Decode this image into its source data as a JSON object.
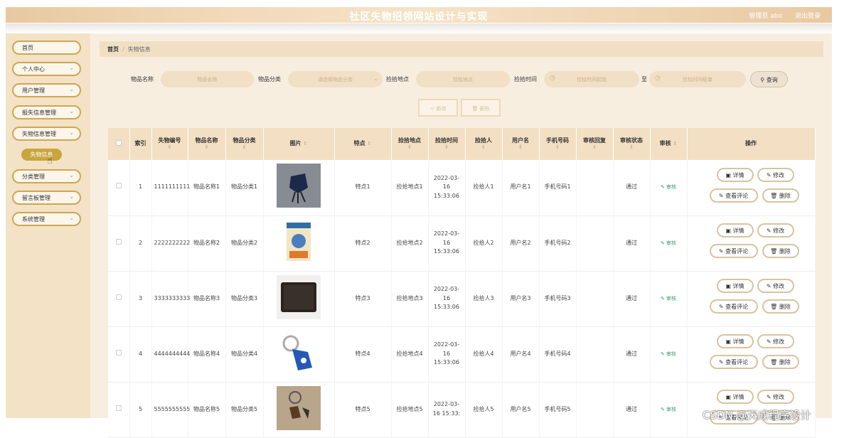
{
  "header": {
    "title": "社区失物招领网站设计与实现",
    "admin": "管理员 abo",
    "logout": "退出登录"
  },
  "sidebar": {
    "items": [
      {
        "label": "首页",
        "has_arrow": false
      },
      {
        "label": "个人中心",
        "has_arrow": true
      },
      {
        "label": "用户管理",
        "has_arrow": true
      },
      {
        "label": "报失信息管理",
        "has_arrow": true
      },
      {
        "label": "失物信息管理",
        "has_arrow": true
      },
      {
        "label": "分类管理",
        "has_arrow": true
      },
      {
        "label": "留言板管理",
        "has_arrow": true
      },
      {
        "label": "系统管理",
        "has_arrow": true
      }
    ],
    "active_sub": "失物信息"
  },
  "breadcrumb": {
    "home": "首页",
    "sep": "/",
    "current": "失物信息"
  },
  "filters": {
    "name_label": "物品名称",
    "name_placeholder": "物品名称",
    "category_label": "物品分类",
    "category_placeholder": "请选择物品分类",
    "place_label": "捡拾地点",
    "place_placeholder": "捡拾地点",
    "time_label": "捡拾时间",
    "time_start_placeholder": "捡拾时间起始",
    "to_label": "至",
    "time_end_placeholder": "捡拾时间结束",
    "search_label": "查询"
  },
  "actions": {
    "add": "新增",
    "delete": "删除"
  },
  "table": {
    "headers": {
      "index": "索引",
      "code": "失物编号",
      "name": "物品名称",
      "category": "物品分类",
      "image": "图片",
      "feature": "特点",
      "place": "捡拾地点",
      "time": "捡拾时间",
      "finder": "捡拾人",
      "username": "用户名",
      "phone": "手机号码",
      "reply": "审核回复",
      "status": "审核状态",
      "review": "审核",
      "ops": "操作"
    },
    "rows": [
      {
        "index": "1",
        "code": "1111111111",
        "name": "物品名称1",
        "category": "物品分类1",
        "feature": "特点1",
        "place": "捡拾地点1",
        "time": "2022-03-16 15:33:06",
        "finder": "捡拾人1",
        "username": "用户名1",
        "phone": "手机号码1",
        "reply": "",
        "status": "通过",
        "review": "审核"
      },
      {
        "index": "2",
        "code": "2222222222",
        "name": "物品名称2",
        "category": "物品分类2",
        "feature": "特点2",
        "place": "捡拾地点2",
        "time": "2022-03-16 15:33:06",
        "finder": "捡拾人2",
        "username": "用户名2",
        "phone": "手机号码2",
        "reply": "",
        "status": "通过",
        "review": "审核"
      },
      {
        "index": "3",
        "code": "3333333333",
        "name": "物品名称3",
        "category": "物品分类3",
        "feature": "特点3",
        "place": "捡拾地点3",
        "time": "2022-03-16 15:33:06",
        "finder": "捡拾人3",
        "username": "用户名3",
        "phone": "手机号码3",
        "reply": "",
        "status": "通过",
        "review": "审核"
      },
      {
        "index": "4",
        "code": "4444444444",
        "name": "物品名称4",
        "category": "物品分类4",
        "feature": "特点4",
        "place": "捡拾地点4",
        "time": "2022-03-16 15:33:06",
        "finder": "捡拾人4",
        "username": "用户名4",
        "phone": "手机号码4",
        "reply": "",
        "status": "通过",
        "review": "审核"
      },
      {
        "index": "5",
        "code": "5555555555",
        "name": "物品名称5",
        "category": "物品分类5",
        "feature": "特点5",
        "place": "捡拾地点5",
        "time": "2022-03-16 15:33:",
        "finder": "捡拾人5",
        "username": "用户名5",
        "phone": "手机号码5",
        "reply": "",
        "status": "通过",
        "review": "审核"
      }
    ],
    "row_buttons": {
      "detail": "详情",
      "edit": "修改",
      "comments": "查看评论",
      "delete": "删除"
    }
  },
  "watermark": "CSDN @天成程序设计",
  "colors": {
    "accent": "#cfa751",
    "sidebar_bg": "#f3e2c6",
    "main_bg": "#f8eedf",
    "active_pill": "#c9a53d",
    "review_green": "#3aa06a"
  }
}
